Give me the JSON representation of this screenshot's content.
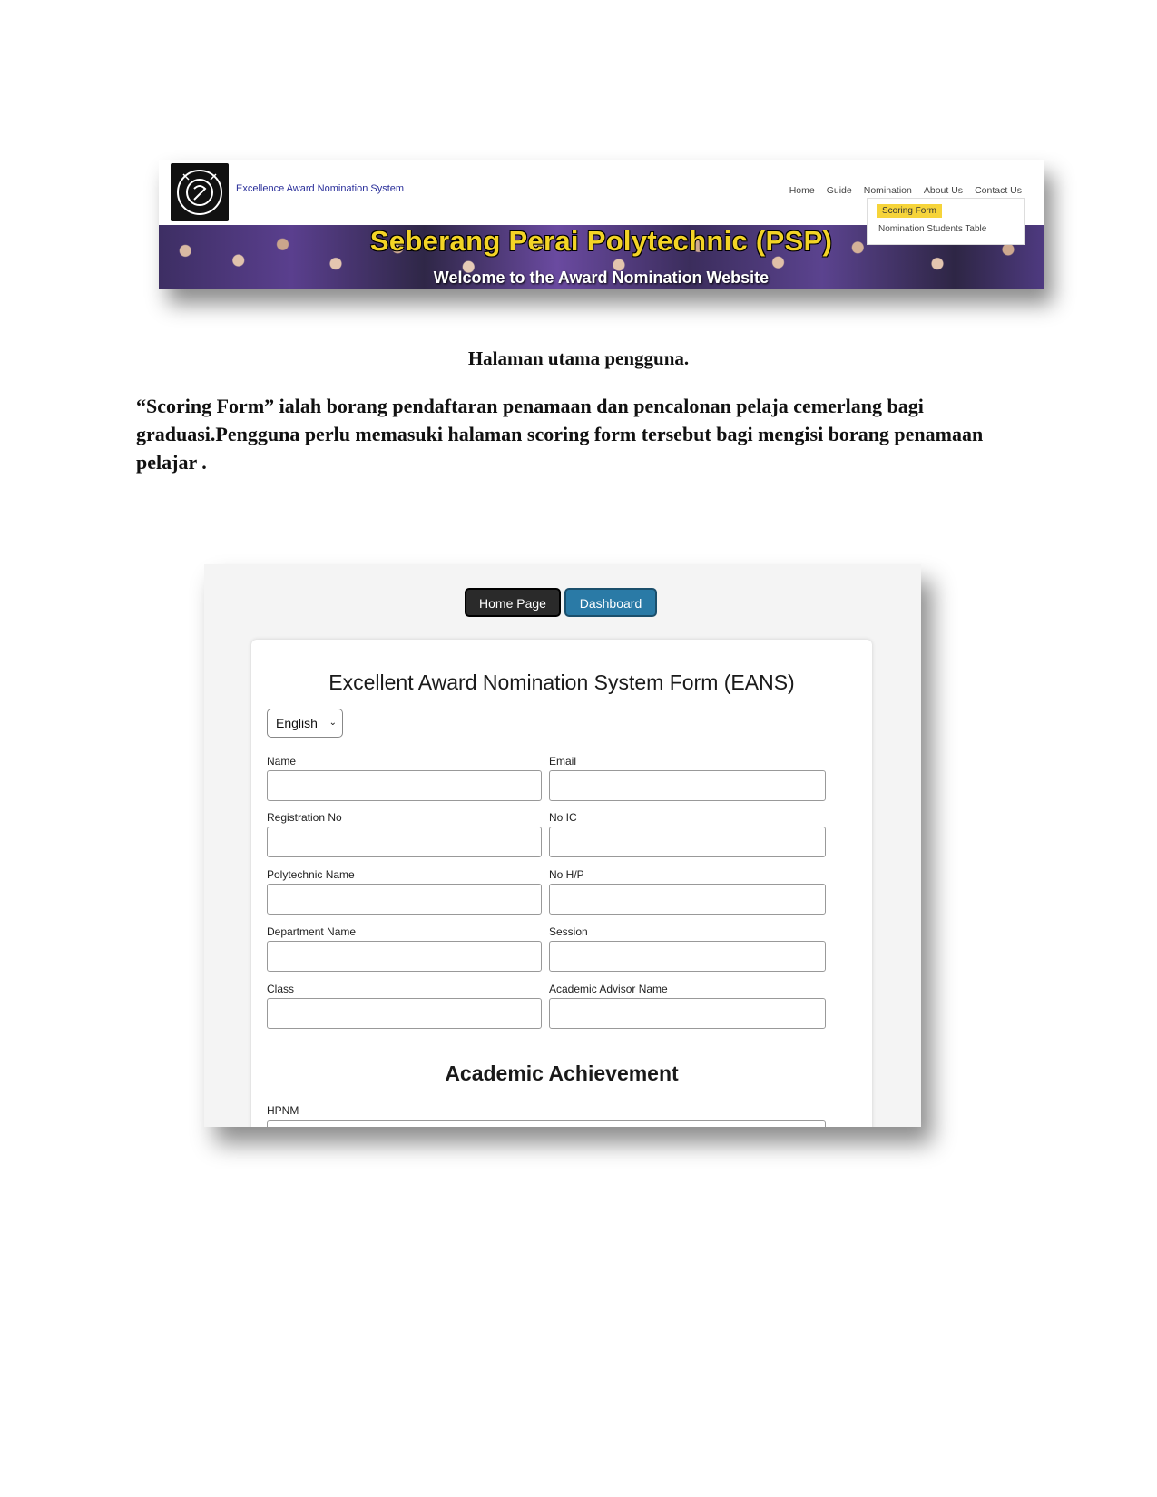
{
  "website": {
    "system_name": "Excellence Award Nomination System",
    "logo_alt": "Sijil logo",
    "nav": [
      "Home",
      "Guide",
      "Nomination",
      "About Us",
      "Contact Us"
    ],
    "dropdown": {
      "scoring_form": "Scoring Form",
      "students_table": "Nomination Students Table"
    },
    "banner_title": "Seberang Perai Polytechnic (PSP)",
    "banner_welcome": "Welcome to the Award Nomination Website"
  },
  "caption": "Halaman utama pengguna.",
  "paragraph": "“Scoring Form” ialah borang pendaftaran penamaan dan pencalonan pelaja cemerlang bagi graduasi.Pengguna perlu memasuki halaman scoring form tersebut bagi mengisi borang penamaan pelajar .",
  "form_page": {
    "buttons": {
      "home": "Home Page",
      "dashboard": "Dashboard"
    },
    "title": "Excellent Award Nomination System Form (EANS)",
    "language": "English",
    "fields": {
      "name": "Name",
      "email": "Email",
      "registration_no": "Registration No",
      "no_ic": "No IC",
      "polytechnic_name": "Polytechnic Name",
      "no_hp": "No H/P",
      "department_name": "Department Name",
      "session": "Session",
      "class": "Class",
      "academic_advisor": "Academic Advisor Name"
    },
    "section_academic": "Academic Achievement",
    "hpnm_label": "HPNM"
  }
}
